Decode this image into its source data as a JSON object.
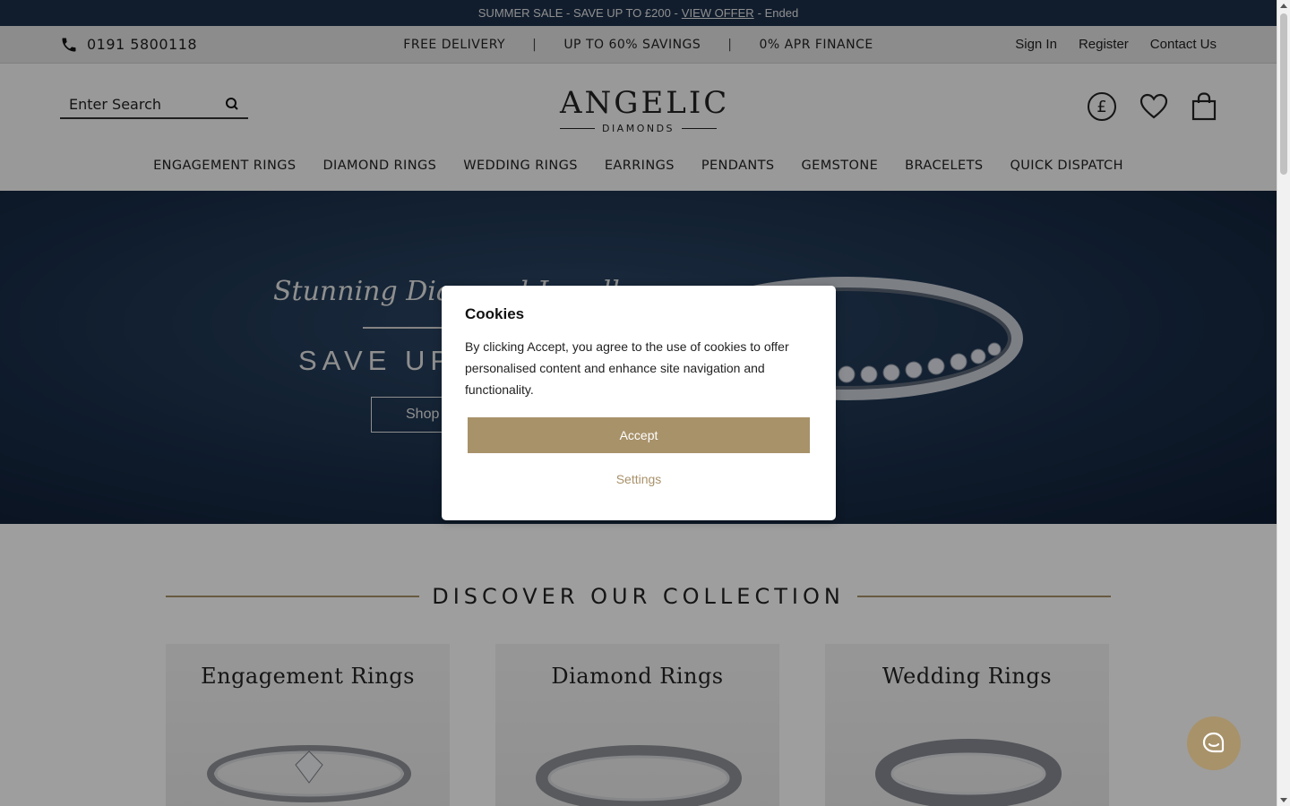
{
  "sale_bar": {
    "text_before": "SUMMER SALE - SAVE UP TO £200 -",
    "link": "VIEW OFFER",
    "text_after": "- Ended"
  },
  "info_bar": {
    "phone": "0191 5800118",
    "usps": [
      "FREE DELIVERY",
      "|",
      "UP TO 60% SAVINGS",
      "|",
      "0% APR FINANCE"
    ],
    "links": [
      "Sign In",
      "Register",
      "Contact Us"
    ]
  },
  "header": {
    "search_placeholder": "Enter Search",
    "logo_main": "ANGELIC",
    "logo_sub": "DIAMONDS",
    "currency_symbol": "£",
    "icons": [
      "currency-icon",
      "heart-icon",
      "bag-icon",
      "search-icon"
    ]
  },
  "nav": [
    "ENGAGEMENT RINGS",
    "DIAMOND RINGS",
    "WEDDING RINGS",
    "EARRINGS",
    "PENDANTS",
    "GEMSTONE",
    "BRACELETS",
    "QUICK DISPATCH"
  ],
  "hero": {
    "title": "Stunning Diamond Jewellery",
    "subtitle": "SAVE UP",
    "button": "Shop"
  },
  "collection": {
    "heading": "DISCOVER OUR COLLECTION",
    "cards": [
      "Engagement Rings",
      "Diamond Rings",
      "Wedding Rings"
    ]
  },
  "cookie_modal": {
    "title": "Cookies",
    "body": "By clicking Accept, you agree to the use of cookies to offer personalised content and enhance site navigation and functionality.",
    "accept": "Accept",
    "settings": "Settings"
  },
  "colors": {
    "accent_gold": "#a8926a",
    "navy": "#1c2f4a"
  }
}
